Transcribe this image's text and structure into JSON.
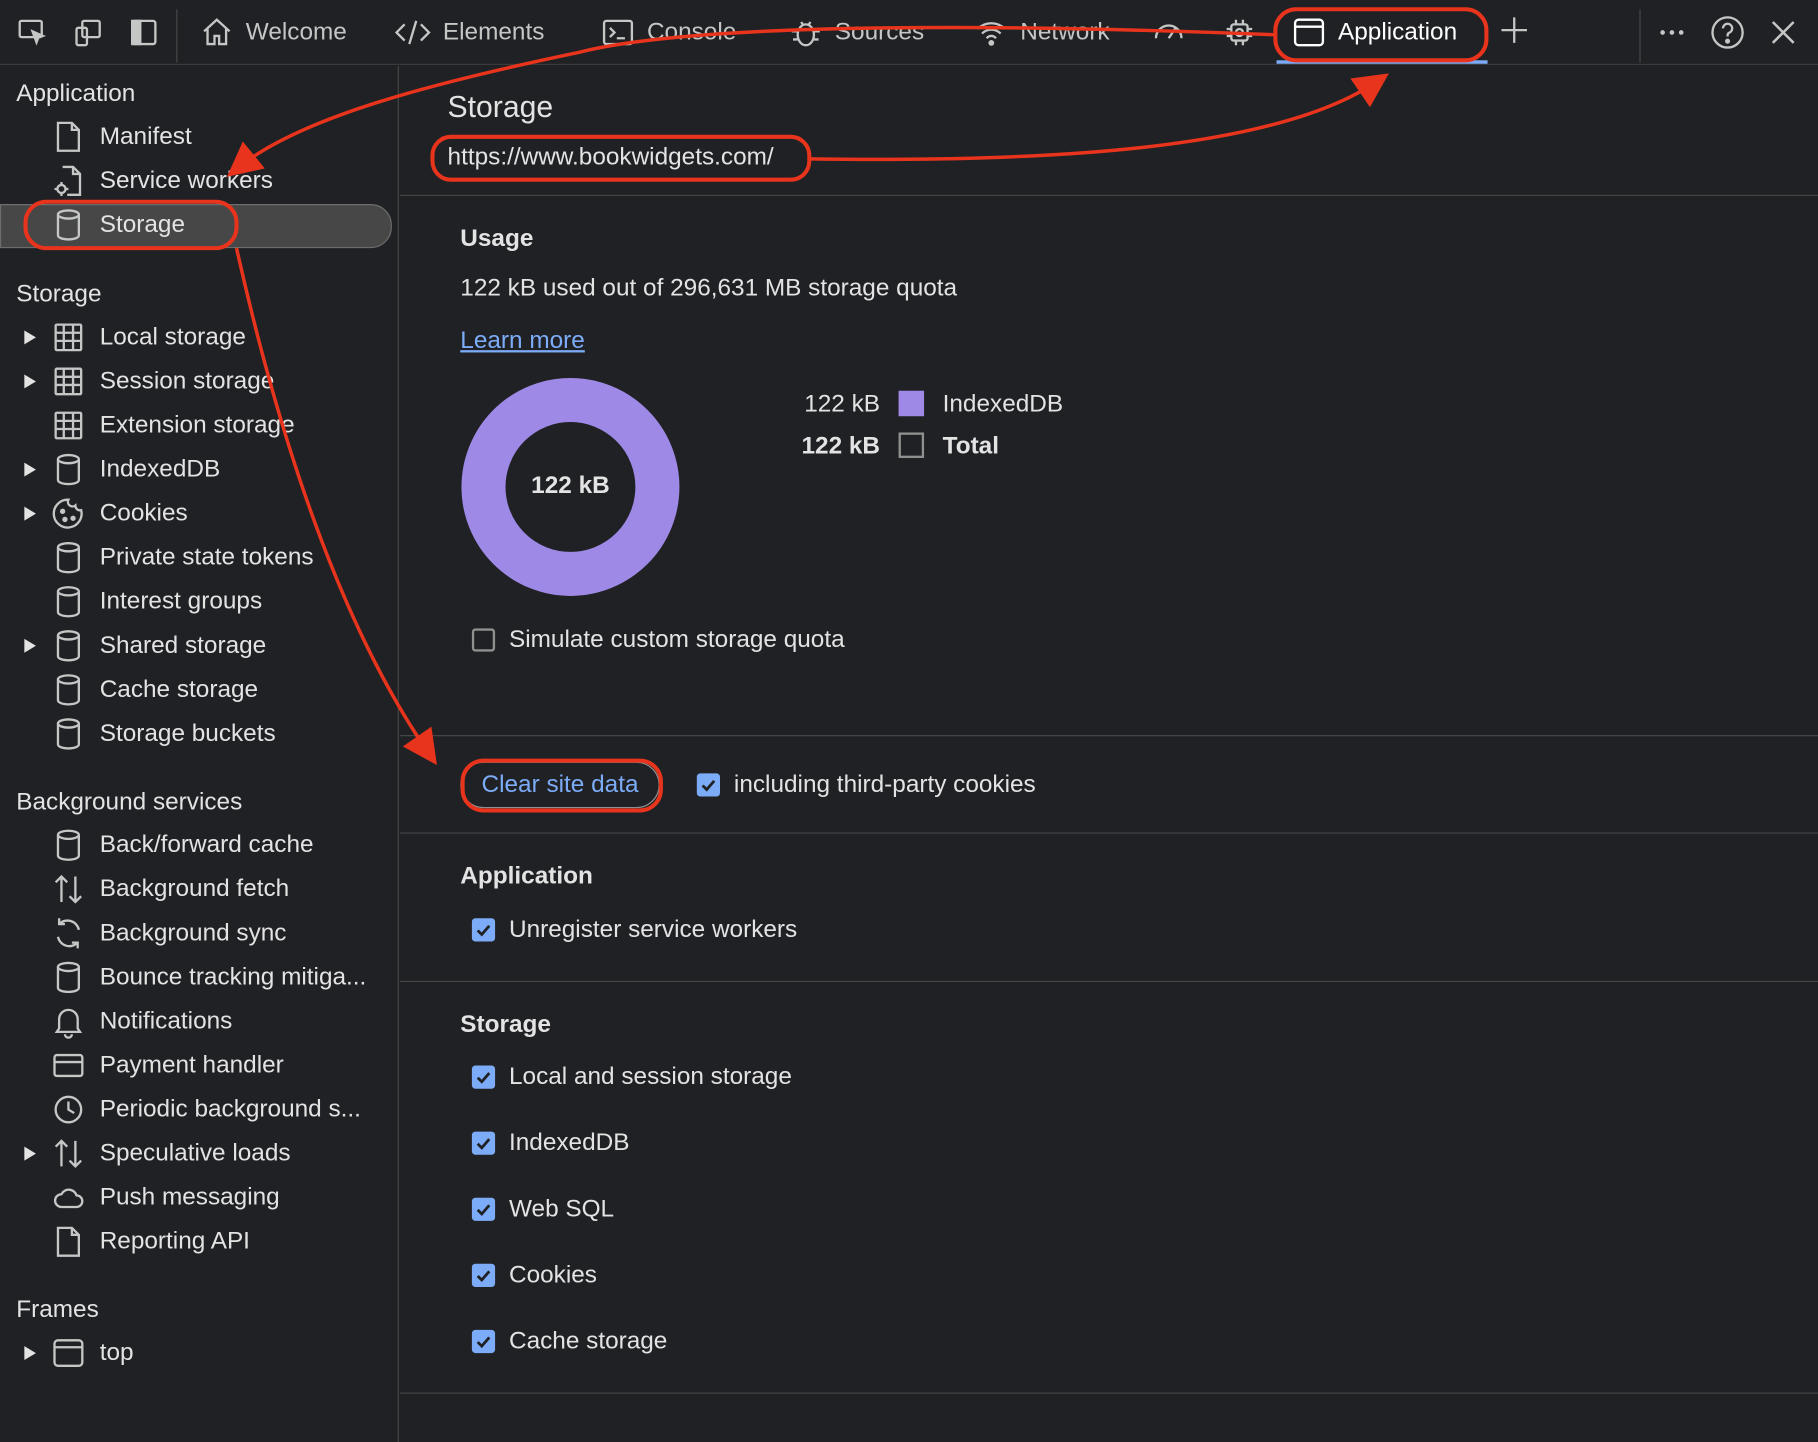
{
  "toolbar": {
    "tabs": [
      {
        "label": "Welcome"
      },
      {
        "label": "Elements"
      },
      {
        "label": "Console"
      },
      {
        "label": "Sources"
      },
      {
        "label": "Network"
      },
      {
        "label": ""
      },
      {
        "label": ""
      },
      {
        "label": "Application"
      }
    ],
    "active_tab": "Application"
  },
  "sidebar": {
    "sections": [
      {
        "title": "Application",
        "items": [
          {
            "label": "Manifest",
            "icon": "document-icon",
            "expandable": false
          },
          {
            "label": "Service workers",
            "icon": "gear-document-icon",
            "expandable": false
          },
          {
            "label": "Storage",
            "icon": "database-icon",
            "expandable": false,
            "selected": true
          }
        ]
      },
      {
        "title": "Storage",
        "items": [
          {
            "label": "Local storage",
            "icon": "table-icon",
            "expandable": true
          },
          {
            "label": "Session storage",
            "icon": "table-icon",
            "expandable": true
          },
          {
            "label": "Extension storage",
            "icon": "table-icon",
            "expandable": false
          },
          {
            "label": "IndexedDB",
            "icon": "database-icon",
            "expandable": true
          },
          {
            "label": "Cookies",
            "icon": "cookie-icon",
            "expandable": true
          },
          {
            "label": "Private state tokens",
            "icon": "database-icon",
            "expandable": false
          },
          {
            "label": "Interest groups",
            "icon": "database-icon",
            "expandable": false
          },
          {
            "label": "Shared storage",
            "icon": "database-icon",
            "expandable": true
          },
          {
            "label": "Cache storage",
            "icon": "database-icon",
            "expandable": false
          },
          {
            "label": "Storage buckets",
            "icon": "database-icon",
            "expandable": false
          }
        ]
      },
      {
        "title": "Background services",
        "items": [
          {
            "label": "Back/forward cache",
            "icon": "database-icon",
            "expandable": false
          },
          {
            "label": "Background fetch",
            "icon": "up-down-arrows-icon",
            "expandable": false
          },
          {
            "label": "Background sync",
            "icon": "sync-icon",
            "expandable": false
          },
          {
            "label": "Bounce tracking mitiga...",
            "icon": "database-icon",
            "expandable": false
          },
          {
            "label": "Notifications",
            "icon": "bell-icon",
            "expandable": false
          },
          {
            "label": "Payment handler",
            "icon": "credit-card-icon",
            "expandable": false
          },
          {
            "label": "Periodic background s...",
            "icon": "clock-icon",
            "expandable": false
          },
          {
            "label": "Speculative loads",
            "icon": "up-down-arrows-icon",
            "expandable": true
          },
          {
            "label": "Push messaging",
            "icon": "cloud-icon",
            "expandable": false
          },
          {
            "label": "Reporting API",
            "icon": "document-icon",
            "expandable": false
          }
        ]
      },
      {
        "title": "Frames",
        "items": [
          {
            "label": "top",
            "icon": "frame-icon",
            "expandable": true
          }
        ]
      }
    ]
  },
  "main": {
    "title": "Storage",
    "origin": "https://www.bookwidgets.com/",
    "usage": {
      "heading": "Usage",
      "summary": "122 kB used out of 296,631 MB storage quota",
      "learn_more": "Learn more",
      "donut_center": "122 kB",
      "legend": [
        {
          "value": "122 kB",
          "label": "IndexedDB",
          "color": "#9e8ae6",
          "bold": false
        },
        {
          "value": "122 kB",
          "label": "Total",
          "color": "",
          "bold": true
        }
      ],
      "simulate_label": "Simulate custom storage quota",
      "simulate_checked": false
    },
    "clear": {
      "button": "Clear site data",
      "third_party_label": "including third-party cookies",
      "third_party_checked": true
    },
    "application_section": {
      "heading": "Application",
      "options": [
        {
          "label": "Unregister service workers",
          "checked": true
        }
      ]
    },
    "storage_section": {
      "heading": "Storage",
      "options": [
        {
          "label": "Local and session storage",
          "checked": true
        },
        {
          "label": "IndexedDB",
          "checked": true
        },
        {
          "label": "Web SQL",
          "checked": true
        },
        {
          "label": "Cookies",
          "checked": true
        },
        {
          "label": "Cache storage",
          "checked": true
        }
      ]
    }
  },
  "colors": {
    "accent": "#7cacf8",
    "annotation": "#e8341c",
    "donut": "#9e8ae6",
    "background": "#202124"
  }
}
